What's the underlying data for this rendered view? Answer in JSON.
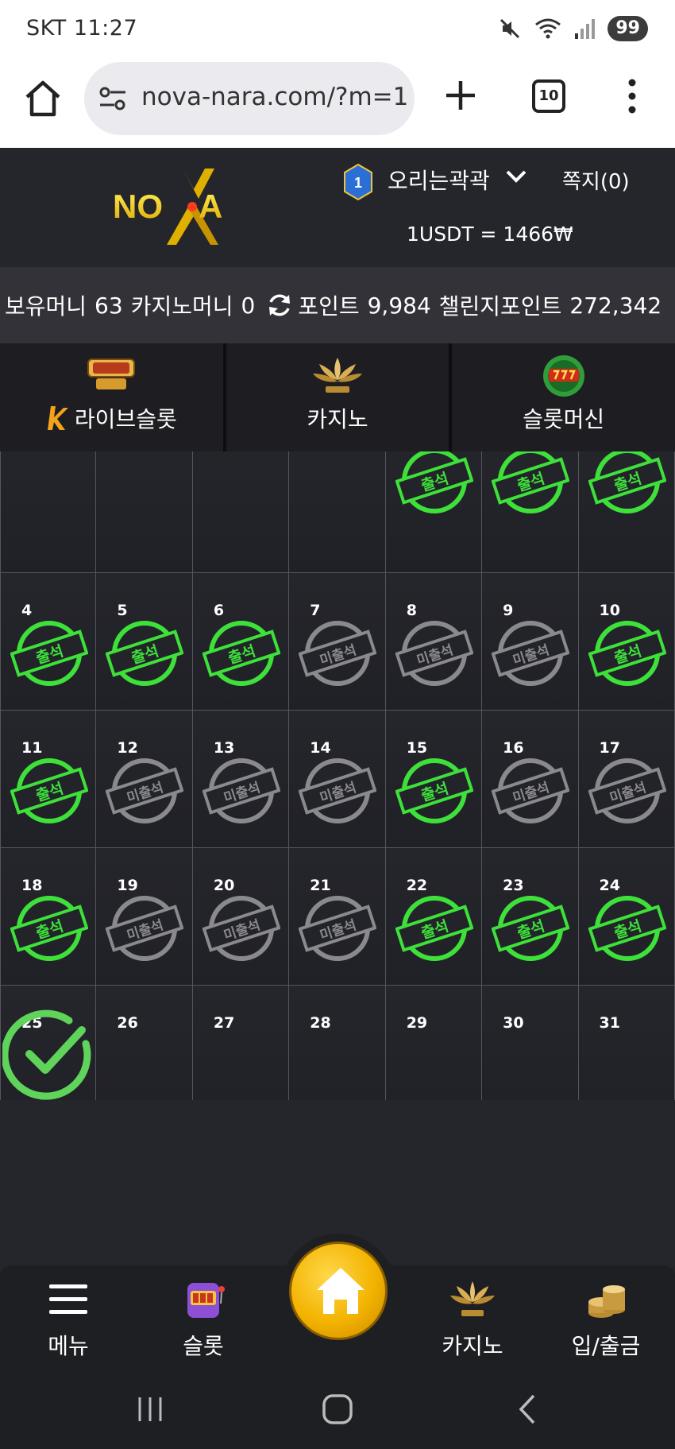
{
  "status_bar": {
    "carrier_time": "SKT 11:27",
    "battery": "99"
  },
  "browser": {
    "url": "nova-nara.com/?m=1",
    "tab_count": "10"
  },
  "header": {
    "logo_text": "NOVA",
    "rank_badge": "1",
    "username": "오리는곽곽",
    "messages_label": "쪽지(0)",
    "exchange_rate": "1USDT = 1466₩"
  },
  "balance": {
    "holding_money_label": "보유머니",
    "holding_money_value": "63",
    "casino_money_label": "카지노머니",
    "casino_money_value": "0",
    "point_label": "포인트",
    "point_value": "9,984",
    "challenge_point_label": "챌린지포인트",
    "challenge_point_value": "272,342"
  },
  "category_tabs": [
    {
      "label": "라이브슬롯",
      "icon": "live-slot-icon"
    },
    {
      "label": "카지노",
      "icon": "k-slot-casino-icon"
    },
    {
      "label": "슬롯머신",
      "icon": "777-slots-icon"
    }
  ],
  "attendance": {
    "present_label": "출석",
    "absent_label": "미출석",
    "colors": {
      "present": "#3ee03a",
      "absent": "#8a8a8e",
      "today_check": "#5fd35a"
    },
    "weeks": [
      [
        {
          "day": "",
          "status": ""
        },
        {
          "day": "",
          "status": ""
        },
        {
          "day": "",
          "status": ""
        },
        {
          "day": "",
          "status": ""
        },
        {
          "day": "",
          "status": "present"
        },
        {
          "day": "",
          "status": "present"
        },
        {
          "day": "",
          "status": "present"
        }
      ],
      [
        {
          "day": "4",
          "status": "present"
        },
        {
          "day": "5",
          "status": "present"
        },
        {
          "day": "6",
          "status": "present"
        },
        {
          "day": "7",
          "status": "absent"
        },
        {
          "day": "8",
          "status": "absent"
        },
        {
          "day": "9",
          "status": "absent"
        },
        {
          "day": "10",
          "status": "present"
        }
      ],
      [
        {
          "day": "11",
          "status": "present"
        },
        {
          "day": "12",
          "status": "absent"
        },
        {
          "day": "13",
          "status": "absent"
        },
        {
          "day": "14",
          "status": "absent"
        },
        {
          "day": "15",
          "status": "present"
        },
        {
          "day": "16",
          "status": "absent"
        },
        {
          "day": "17",
          "status": "absent"
        }
      ],
      [
        {
          "day": "18",
          "status": "present"
        },
        {
          "day": "19",
          "status": "absent"
        },
        {
          "day": "20",
          "status": "absent"
        },
        {
          "day": "21",
          "status": "absent"
        },
        {
          "day": "22",
          "status": "present"
        },
        {
          "day": "23",
          "status": "present"
        },
        {
          "day": "24",
          "status": "present"
        }
      ],
      [
        {
          "day": "25",
          "status": "today"
        },
        {
          "day": "26",
          "status": ""
        },
        {
          "day": "27",
          "status": ""
        },
        {
          "day": "28",
          "status": ""
        },
        {
          "day": "29",
          "status": ""
        },
        {
          "day": "30",
          "status": ""
        },
        {
          "day": "31",
          "status": ""
        }
      ]
    ]
  },
  "bottom_nav": {
    "menu": "메뉴",
    "slot": "슬롯",
    "casino": "카지노",
    "deposit_withdraw": "입/출금"
  }
}
